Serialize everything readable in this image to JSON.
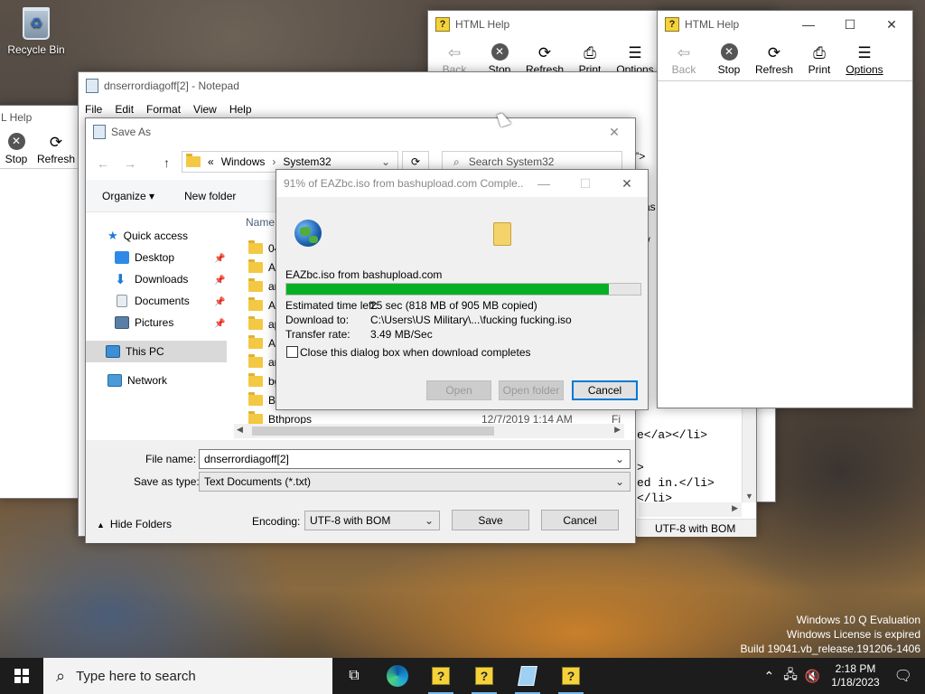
{
  "desktop": {
    "recycle_bin_label": "Recycle Bin",
    "watermark": [
      "Windows 10 Q Evaluation",
      "Windows License is expired",
      "Build 19041.vb_release.191206-1406"
    ]
  },
  "html_help": {
    "title": "HTML Help",
    "partial_title": "L Help",
    "tools": {
      "back": "Back",
      "stop": "Stop",
      "refresh": "Refresh",
      "print": "Print",
      "options": "Options"
    }
  },
  "notepad": {
    "title": "dnserrordiagoff[2] - Notepad",
    "menu": [
      "File",
      "Edit",
      "Format",
      "View",
      "Help"
    ],
    "snippets": [
      "\">",
      "as",
      "t/",
      "e</a></li>",
      ">",
      "ed in.</li>",
      "</li>"
    ],
    "status_encoding": "UTF-8 with BOM"
  },
  "save_as": {
    "title": "Save As",
    "breadcrumb": [
      "«",
      "Windows",
      "System32"
    ],
    "search_placeholder": "Search System32",
    "organize": "Organize ▾",
    "new_folder": "New folder",
    "column_name": "Name",
    "quick_access": "Quick access",
    "nav": [
      "Desktop",
      "Downloads",
      "Documents",
      "Pictures"
    ],
    "this_pc": "This PC",
    "network": "Network",
    "files": [
      "04",
      "Ad",
      "an",
      "Ap",
      "ap",
      "Ap",
      "ar-",
      "bg",
      "Bo",
      "Bthprops"
    ],
    "last_row_date": "12/7/2019 1:14 AM",
    "last_row_type": "Fi",
    "file_name_label": "File name:",
    "file_name_value": "dnserrordiagoff[2]",
    "save_type_label": "Save as type:",
    "save_type_value": "Text Documents (*.txt)",
    "encoding_label": "Encoding:",
    "encoding_value": "UTF-8 with BOM",
    "hide_folders": "Hide Folders",
    "save": "Save",
    "cancel": "Cancel"
  },
  "download": {
    "title": "91% of EAZbc.iso from bashupload.com Comple...",
    "file_line": "EAZbc.iso from bashupload.com",
    "progress_percent": 91,
    "estimated_label": "Estimated time left:",
    "estimated_value": "25 sec (818 MB of 905 MB copied)",
    "download_to_label": "Download to:",
    "download_to_value": "C:\\Users\\US Military\\...\\fucking fucking.iso",
    "rate_label": "Transfer rate:",
    "rate_value": "3.49 MB/Sec",
    "close_checkbox": "Close this dialog box when download completes",
    "open": "Open",
    "open_folder": "Open folder",
    "cancel": "Cancel"
  },
  "taskbar": {
    "search_placeholder": "Type here to search",
    "time": "2:18 PM",
    "date": "1/18/2023"
  }
}
